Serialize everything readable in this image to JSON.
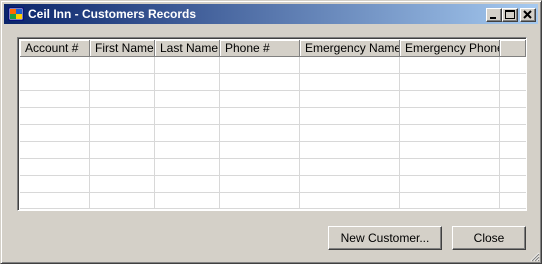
{
  "window": {
    "title": "Ceil Inn - Customers Records",
    "app_icon": "app-window-icon",
    "controls": {
      "minimize": "minimize-icon",
      "maximize": "maximize-icon",
      "close": "close-icon"
    },
    "titlebar_gradient": [
      "#0a246a",
      "#a6caf0"
    ],
    "background": "#d4d0c8"
  },
  "grid": {
    "columns": [
      "Account #",
      "First Name",
      "Last Name",
      "Phone #",
      "Emergency Name",
      "Emergency Phone"
    ],
    "rows": []
  },
  "buttons": {
    "new_customer": "New Customer...",
    "close": "Close"
  }
}
